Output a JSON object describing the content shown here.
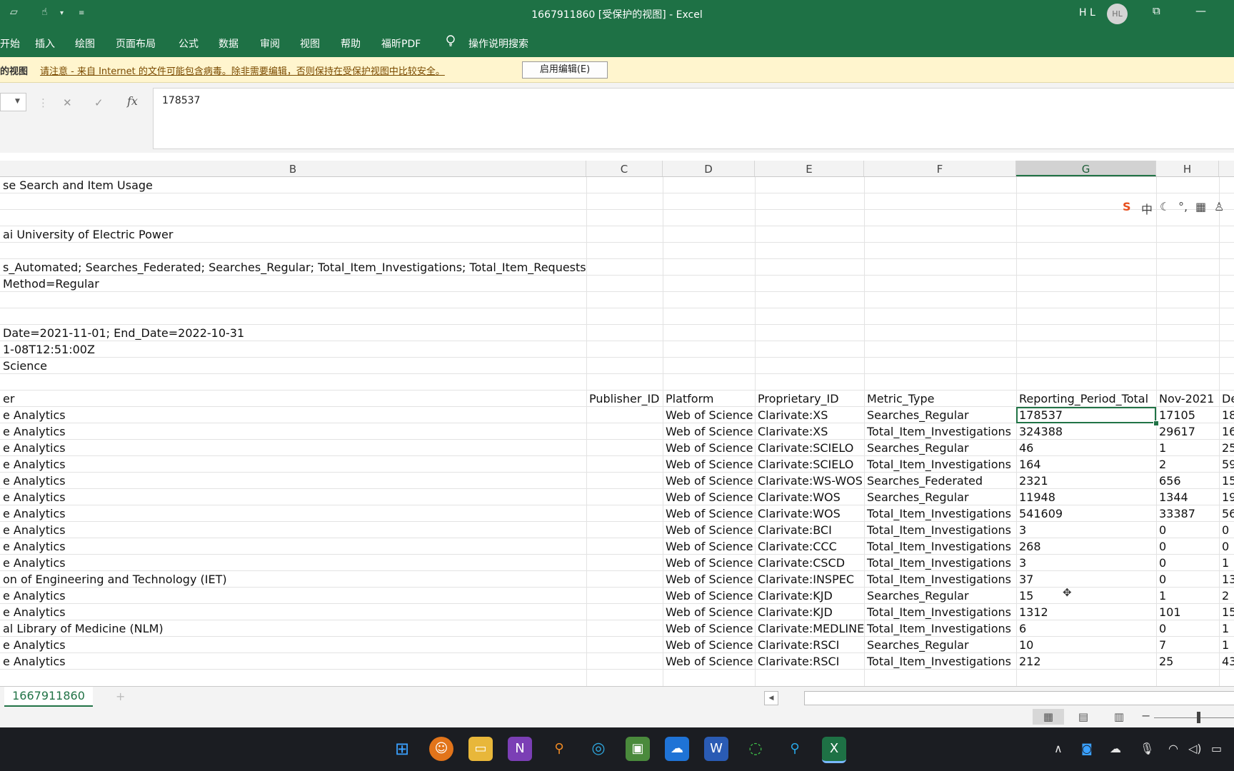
{
  "window": {
    "title": "1667911860  [受保护的视图]  -  Excel",
    "user_initials": "H L",
    "avatar": "HL"
  },
  "ribbon": {
    "tabs": [
      "开始",
      "插入",
      "绘图",
      "页面布局",
      "公式",
      "数据",
      "审阅",
      "视图",
      "帮助",
      "福昕PDF"
    ],
    "tell_me": "操作说明搜索"
  },
  "message_bar": {
    "title": "的视图",
    "text": "请注意 - 来自 Internet 的文件可能包含病毒。除非需要编辑，否则保持在受保护视图中比较安全。",
    "button": "启用编辑(E)"
  },
  "formula_bar": {
    "fx": "fx",
    "value": "178537"
  },
  "columns": [
    "B",
    "C",
    "D",
    "E",
    "F",
    "G",
    "H"
  ],
  "selected_column": "G",
  "rows": [
    {
      "b": "se Search and Item Usage"
    },
    {
      "b": ""
    },
    {
      "b": ""
    },
    {
      "b": "ai University of Electric Power"
    },
    {
      "b": ""
    },
    {
      "b": "s_Automated; Searches_Federated; Searches_Regular; Total_Item_Investigations; Total_Item_Requests"
    },
    {
      "b": "Method=Regular"
    },
    {
      "b": ""
    },
    {
      "b": ""
    },
    {
      "b": "Date=2021-11-01; End_Date=2022-10-31"
    },
    {
      "b": "1-08T12:51:00Z"
    },
    {
      "b": "Science"
    },
    {
      "b": ""
    },
    {
      "b": "er",
      "c": "Publisher_ID",
      "d": "Platform",
      "e": "Proprietary_ID",
      "f": "Metric_Type",
      "g": "Reporting_Period_Total",
      "h": "Nov-2021",
      "i": "De"
    },
    {
      "b": "e Analytics",
      "c": "",
      "d": "Web of Science",
      "e": "Clarivate:XS",
      "f": "Searches_Regular",
      "g": "178537",
      "h": "17105",
      "i": "18"
    },
    {
      "b": "e Analytics",
      "c": "",
      "d": "Web of Science",
      "e": "Clarivate:XS",
      "f": "Total_Item_Investigations",
      "g": "324388",
      "h": "29617",
      "i": "16"
    },
    {
      "b": "e Analytics",
      "c": "",
      "d": "Web of Science",
      "e": "Clarivate:SCIELO",
      "f": "Searches_Regular",
      "g": "46",
      "h": "1",
      "i": "25"
    },
    {
      "b": "e Analytics",
      "c": "",
      "d": "Web of Science",
      "e": "Clarivate:SCIELO",
      "f": "Total_Item_Investigations",
      "g": "164",
      "h": "2",
      "i": "59"
    },
    {
      "b": "e Analytics",
      "c": "",
      "d": "Web of Science",
      "e": "Clarivate:WS-WOS",
      "f": "Searches_Federated",
      "g": "2321",
      "h": "656",
      "i": "15"
    },
    {
      "b": "e Analytics",
      "c": "",
      "d": "Web of Science",
      "e": "Clarivate:WOS",
      "f": "Searches_Regular",
      "g": "11948",
      "h": "1344",
      "i": "19"
    },
    {
      "b": "e Analytics",
      "c": "",
      "d": "Web of Science",
      "e": "Clarivate:WOS",
      "f": "Total_Item_Investigations",
      "g": "541609",
      "h": "33387",
      "i": "56"
    },
    {
      "b": "e Analytics",
      "c": "",
      "d": "Web of Science",
      "e": "Clarivate:BCI",
      "f": "Total_Item_Investigations",
      "g": "3",
      "h": "0",
      "i": "0"
    },
    {
      "b": "e Analytics",
      "c": "",
      "d": "Web of Science",
      "e": "Clarivate:CCC",
      "f": "Total_Item_Investigations",
      "g": "268",
      "h": "0",
      "i": "0"
    },
    {
      "b": "e Analytics",
      "c": "",
      "d": "Web of Science",
      "e": "Clarivate:CSCD",
      "f": "Total_Item_Investigations",
      "g": "3",
      "h": "0",
      "i": "1"
    },
    {
      "b": "on of Engineering and Technology (IET)",
      "c": "",
      "d": "Web of Science",
      "e": "Clarivate:INSPEC",
      "f": "Total_Item_Investigations",
      "g": "37",
      "h": "0",
      "i": "13"
    },
    {
      "b": "e Analytics",
      "c": "",
      "d": "Web of Science",
      "e": "Clarivate:KJD",
      "f": "Searches_Regular",
      "g": "15",
      "h": "1",
      "i": "2"
    },
    {
      "b": "e Analytics",
      "c": "",
      "d": "Web of Science",
      "e": "Clarivate:KJD",
      "f": "Total_Item_Investigations",
      "g": "1312",
      "h": "101",
      "i": "15"
    },
    {
      "b": "al Library of Medicine (NLM)",
      "c": "",
      "d": "Web of Science",
      "e": "Clarivate:MEDLINE",
      "f": "Total_Item_Investigations",
      "g": "6",
      "h": "0",
      "i": "1"
    },
    {
      "b": "e Analytics",
      "c": "",
      "d": "Web of Science",
      "e": "Clarivate:RSCI",
      "f": "Searches_Regular",
      "g": "10",
      "h": "7",
      "i": "1"
    },
    {
      "b": "e Analytics",
      "c": "",
      "d": "Web of Science",
      "e": "Clarivate:RSCI",
      "f": "Total_Item_Investigations",
      "g": "212",
      "h": "25",
      "i": "43"
    }
  ],
  "sheet_tabs": [
    "1667911860"
  ],
  "colors": {
    "excel_green": "#1e7145",
    "accent": "#217346",
    "message_bar": "#fff5ce"
  }
}
